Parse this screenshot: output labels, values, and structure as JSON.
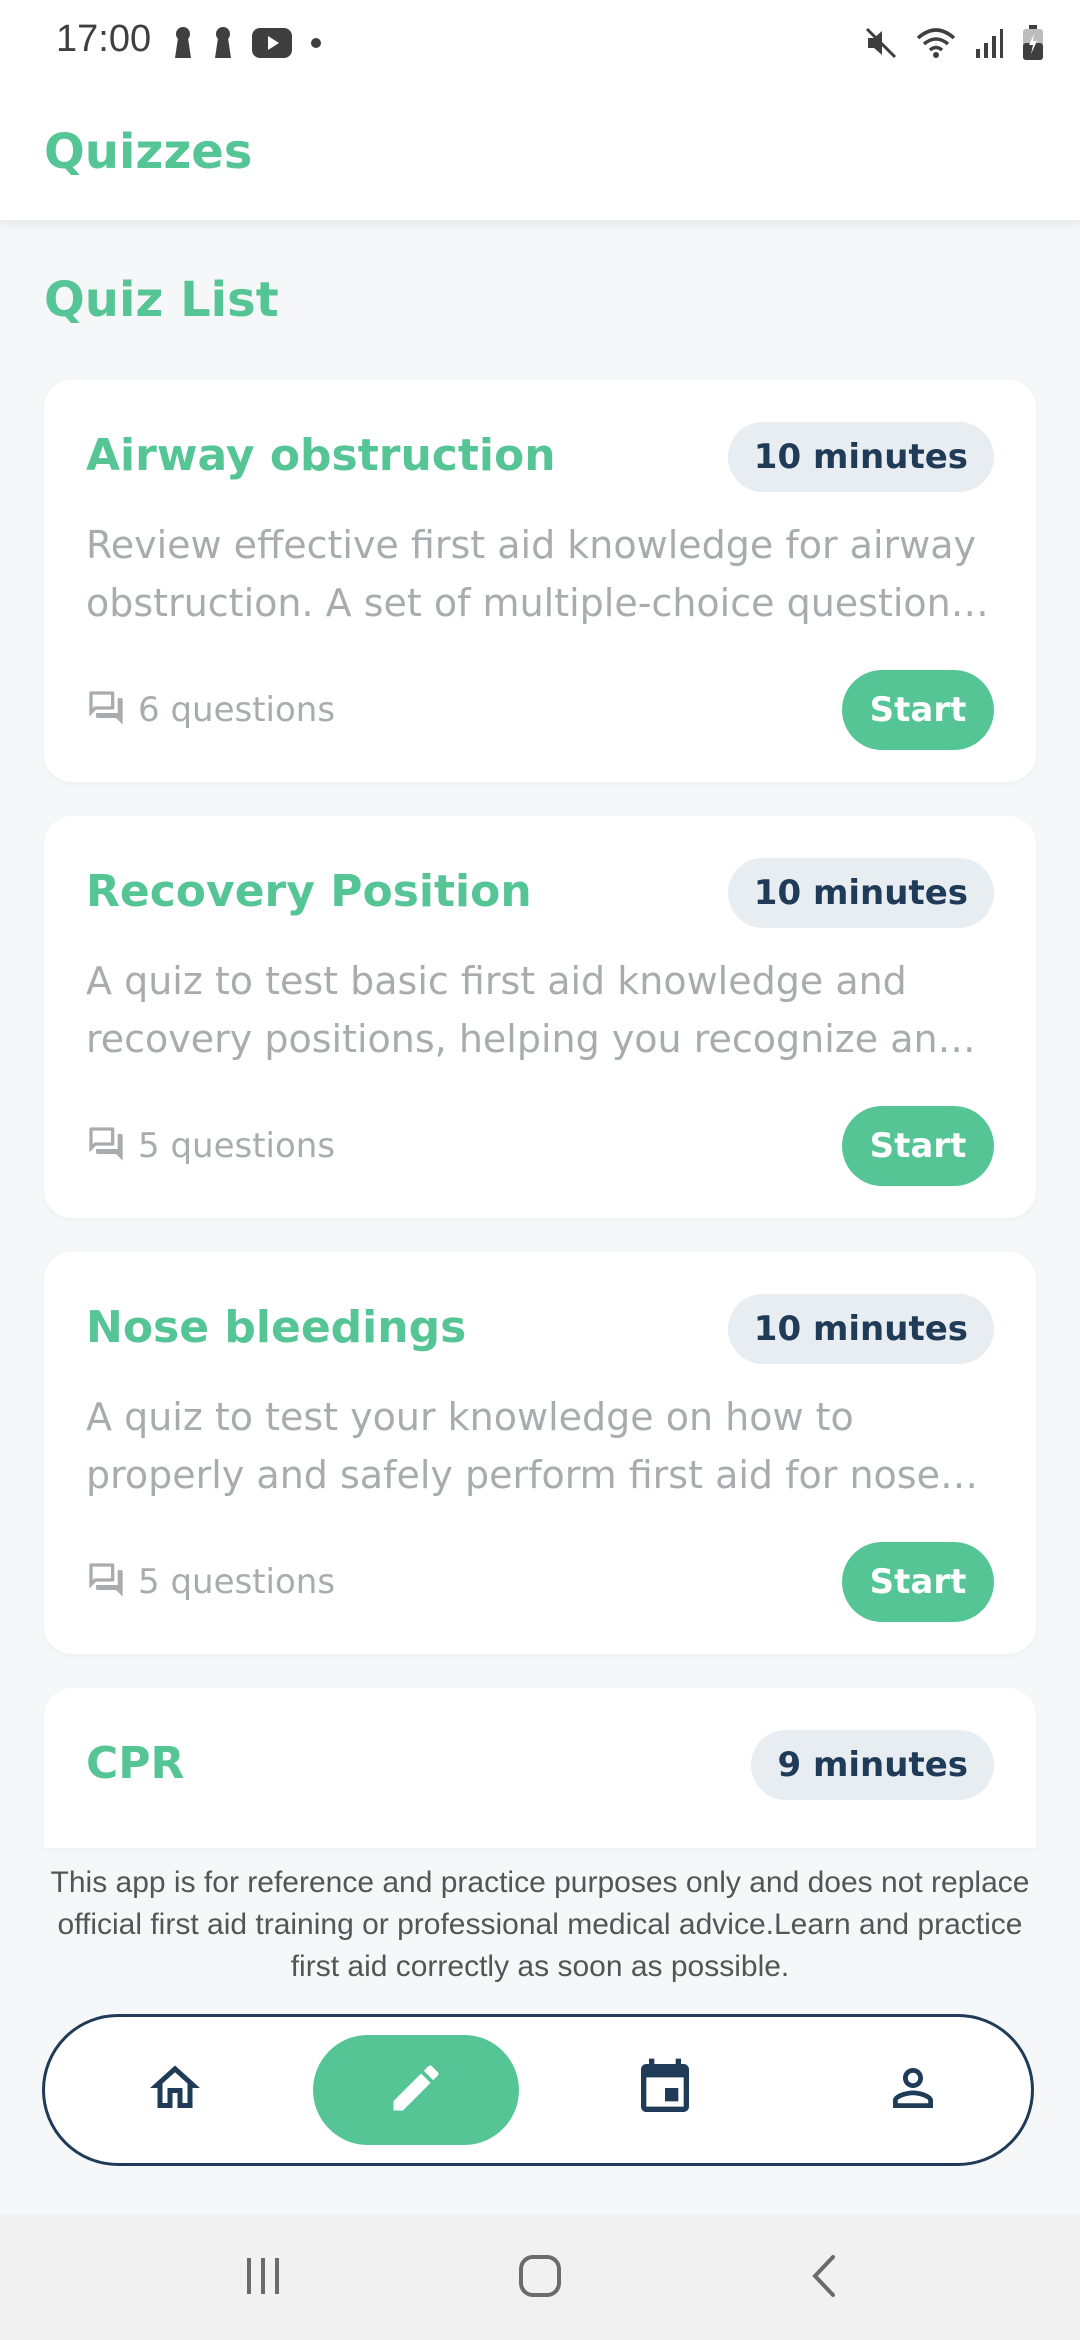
{
  "status_bar": {
    "time": "17:00",
    "left_icons": [
      "keyhole-icon",
      "keyhole-icon",
      "youtube-icon",
      "dot-icon"
    ],
    "right_icons": [
      "mute-icon",
      "wifi-icon",
      "signal-icon",
      "battery-icon"
    ]
  },
  "app_bar": {
    "title": "Quizzes"
  },
  "section": {
    "title": "Quiz List"
  },
  "quizzes": [
    {
      "title": "Airway obstruction",
      "duration": "10 minutes",
      "description": "Review effective first aid knowledge for airway obstruction. A set of multiple-choice questions to test your knowledge.",
      "questions": "6 questions",
      "start_label": "Start"
    },
    {
      "title": "Recovery Position",
      "duration": "10 minutes",
      "description": "A quiz to test basic first aid knowledge and recovery positions, helping you recognize and respond correctly.",
      "questions": "5 questions",
      "start_label": "Start"
    },
    {
      "title": "Nose bleedings",
      "duration": "10 minutes",
      "description": "A quiz to test your knowledge on how to properly and safely perform first aid for nose bleedings.",
      "questions": "5 questions",
      "start_label": "Start"
    },
    {
      "title": "CPR",
      "duration": "9 minutes"
    }
  ],
  "disclaimer": "This app is for reference and practice purposes only and does not replace official first aid training or professional medical advice.Learn and practice first aid correctly as soon as possible.",
  "bottom_nav": {
    "items": [
      "home-icon",
      "pencil-icon",
      "calendar-icon",
      "person-icon"
    ],
    "active": "pencil-icon"
  },
  "colors": {
    "accent": "#56C596",
    "navy": "#1F3B57",
    "muted_text": "#A9ACAF",
    "badge_bg": "#E8EDF1"
  }
}
